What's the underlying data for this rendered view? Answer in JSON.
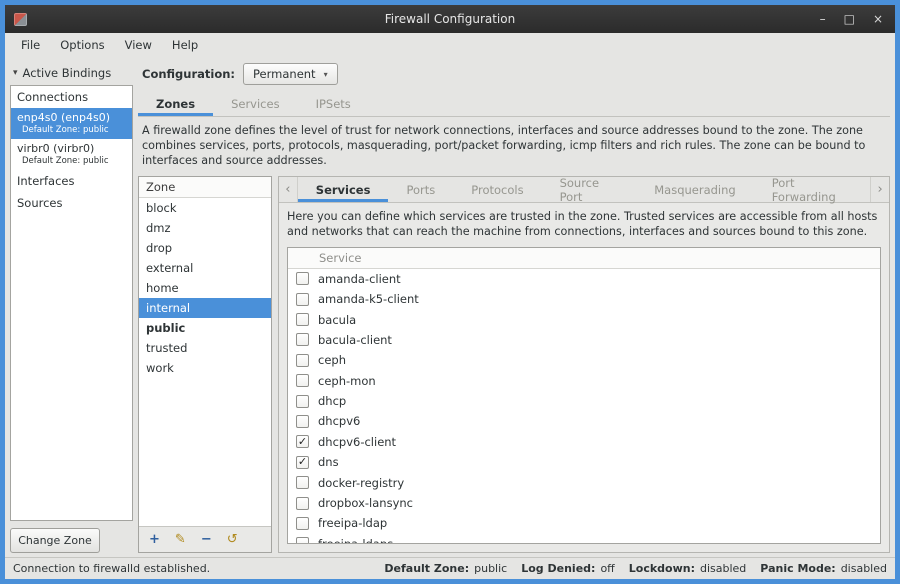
{
  "colors": {
    "accent": "#4a90d9",
    "titlebar": "#2f2f2f",
    "selection": "#4a90d9"
  },
  "icons": {
    "expander_down": "▾",
    "dropdown_arrow": "▾",
    "tab_scroll_left": "‹",
    "tab_scroll_right": "›",
    "add": "+",
    "edit": "✎",
    "remove": "−",
    "load_defaults": "↺",
    "check": "✓",
    "minimize": "–",
    "maximize": "□",
    "close": "×"
  },
  "window": {
    "title": "Firewall Configuration"
  },
  "menu": {
    "items": [
      "File",
      "Options",
      "View",
      "Help"
    ]
  },
  "sidebar": {
    "header": "Active Bindings",
    "connections_label": "Connections",
    "connections": [
      {
        "name": "enp4s0 (enp4s0)",
        "zone": "Default Zone: public",
        "selected": true
      },
      {
        "name": "virbr0 (virbr0)",
        "zone": "Default Zone: public",
        "selected": false
      }
    ],
    "interfaces_label": "Interfaces",
    "sources_label": "Sources",
    "change_zone_button": "Change Zone"
  },
  "toolbar": {
    "configuration_label": "Configuration:",
    "configuration_value": "Permanent"
  },
  "main_tabs": [
    {
      "label": "Zones",
      "active": true
    },
    {
      "label": "Services",
      "active": false
    },
    {
      "label": "IPSets",
      "active": false
    }
  ],
  "zones_description": "A firewalld zone defines the level of trust for network connections, interfaces and source addresses bound to the zone. The zone combines services, ports, protocols, masquerading, port/packet forwarding, icmp filters and rich rules. The zone can be bound to interfaces and source addresses.",
  "zone_list": {
    "header": "Zone",
    "items": [
      {
        "name": "block",
        "selected": false,
        "bold": false
      },
      {
        "name": "dmz",
        "selected": false,
        "bold": false
      },
      {
        "name": "drop",
        "selected": false,
        "bold": false
      },
      {
        "name": "external",
        "selected": false,
        "bold": false
      },
      {
        "name": "home",
        "selected": false,
        "bold": false
      },
      {
        "name": "internal",
        "selected": true,
        "bold": false
      },
      {
        "name": "public",
        "selected": false,
        "bold": true
      },
      {
        "name": "trusted",
        "selected": false,
        "bold": false
      },
      {
        "name": "work",
        "selected": false,
        "bold": false
      }
    ]
  },
  "service_tabs": [
    {
      "label": "Services",
      "active": true
    },
    {
      "label": "Ports",
      "active": false
    },
    {
      "label": "Protocols",
      "active": false
    },
    {
      "label": "Source Port",
      "active": false
    },
    {
      "label": "Masquerading",
      "active": false
    },
    {
      "label": "Port Forwarding",
      "active": false
    }
  ],
  "services_description": "Here you can define which services are trusted in the zone. Trusted services are accessible from all hosts and networks that can reach the machine from connections, interfaces and sources bound to this zone.",
  "service_list": {
    "header": "Service",
    "items": [
      {
        "name": "amanda-client",
        "checked": false
      },
      {
        "name": "amanda-k5-client",
        "checked": false
      },
      {
        "name": "bacula",
        "checked": false
      },
      {
        "name": "bacula-client",
        "checked": false
      },
      {
        "name": "ceph",
        "checked": false
      },
      {
        "name": "ceph-mon",
        "checked": false
      },
      {
        "name": "dhcp",
        "checked": false
      },
      {
        "name": "dhcpv6",
        "checked": false
      },
      {
        "name": "dhcpv6-client",
        "checked": true
      },
      {
        "name": "dns",
        "checked": true
      },
      {
        "name": "docker-registry",
        "checked": false
      },
      {
        "name": "dropbox-lansync",
        "checked": false
      },
      {
        "name": "freeipa-ldap",
        "checked": false
      },
      {
        "name": "freeipa-ldaps",
        "checked": false
      }
    ]
  },
  "statusbar": {
    "left": "Connection to firewalld established.",
    "right": [
      {
        "label": "Default Zone:",
        "value": "public"
      },
      {
        "label": "Log Denied:",
        "value": "off"
      },
      {
        "label": "Lockdown:",
        "value": "disabled"
      },
      {
        "label": "Panic Mode:",
        "value": "disabled"
      }
    ]
  }
}
